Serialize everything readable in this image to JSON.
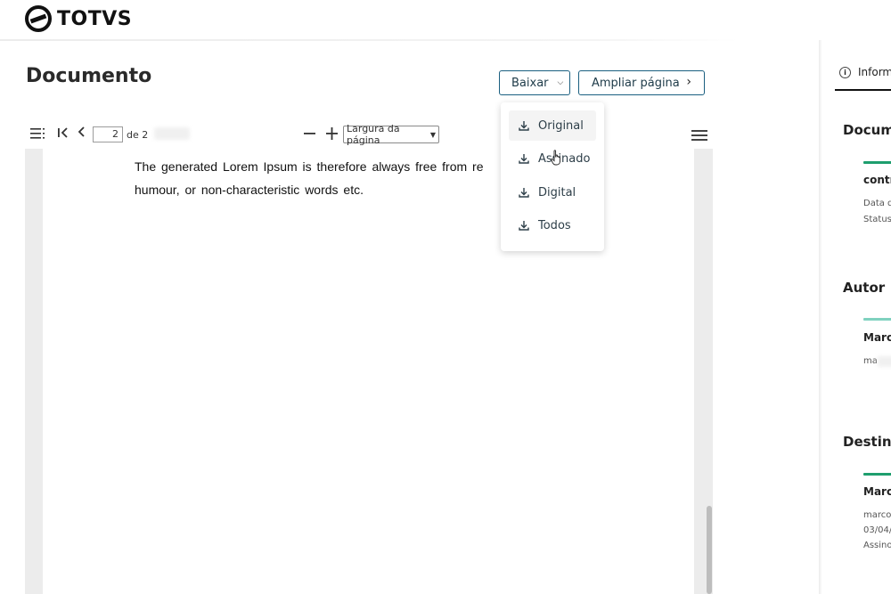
{
  "header": {
    "brand": "TOTVS"
  },
  "page": {
    "title": "Documento",
    "download_button": "Baixar",
    "expand_button": "Ampliar página"
  },
  "download_menu": {
    "items": [
      "Original",
      "Assinado",
      "Digital",
      "Todos"
    ]
  },
  "viewer": {
    "current_page": "2",
    "page_of": "de 2",
    "zoom_option": "Largura da página",
    "text": "The generated Lorem Ipsum is therefore always free from re humour, or non-characteristic words etc."
  },
  "sidebar": {
    "tab": "Informações",
    "sections": {
      "documento": {
        "title": "Documento",
        "name": "contrato",
        "meta": [
          "Data de criação",
          "Status"
        ]
      },
      "autor": {
        "title": "Autor",
        "name": "Marcos",
        "meta": [
          "ma"
        ]
      },
      "destinatarios": {
        "title": "Destinatários",
        "name": "Marcos",
        "meta": [
          "marcos",
          "03/04/",
          "Assinou"
        ]
      }
    }
  },
  "colors": {
    "accent": "#1a5f80",
    "success": "#1e9e6e",
    "success_light": "#7fd1bf"
  }
}
